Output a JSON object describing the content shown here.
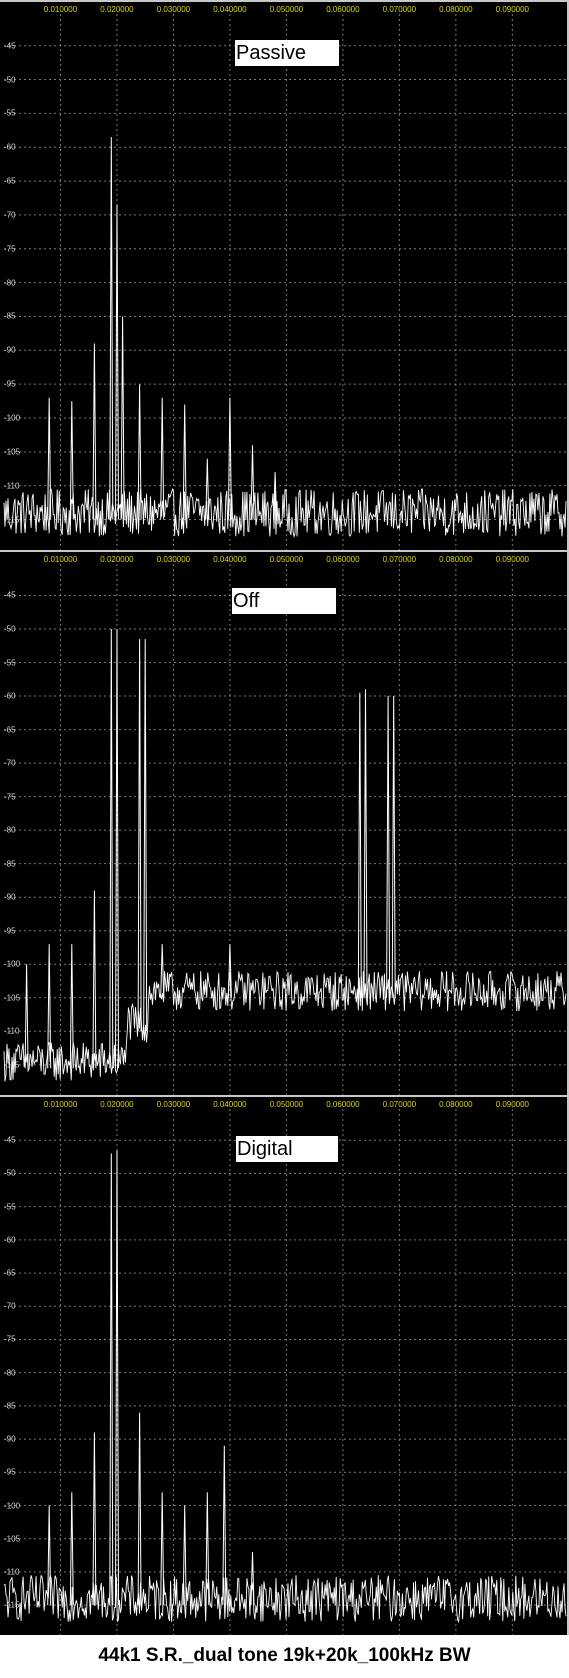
{
  "caption": "44k1 S.R._dual tone 19k+20k_100kHz BW",
  "colors": {
    "background": "#000000",
    "trace": "#ffffff",
    "grid": "#7a7a6a",
    "x_tick_label": "#d8d800",
    "y_tick_label": "#d8d8d8"
  },
  "chart_data": [
    {
      "type": "line",
      "title": "Passive",
      "x_tick_labels": [
        "0.010000",
        "0.020000",
        "0.030000",
        "0.040000",
        "0.050000",
        "0.060000",
        "0.070000",
        "0.080000",
        "0.090000"
      ],
      "x_ticks": [
        0.01,
        0.02,
        0.03,
        0.04,
        0.05,
        0.06,
        0.07,
        0.08,
        0.09
      ],
      "xlim": [
        0.0,
        0.0995
      ],
      "y_tick_labels": [
        "-45",
        "-50",
        "-55",
        "-60",
        "-65",
        "-70",
        "-75",
        "-80",
        "-85",
        "-90",
        "-95",
        "-100",
        "-105",
        "-110",
        "-115"
      ],
      "y_ticks": [
        -45,
        -50,
        -55,
        -60,
        -65,
        -70,
        -75,
        -80,
        -85,
        -90,
        -95,
        -100,
        -105,
        -110,
        -115
      ],
      "ylim": [
        -119.5,
        -41.5
      ],
      "grid": true,
      "noise_floor": -114,
      "noise_amplitude": 3.5,
      "peaks": [
        {
          "x": 0.008,
          "y": -97
        },
        {
          "x": 0.012,
          "y": -97.5
        },
        {
          "x": 0.016,
          "y": -89
        },
        {
          "x": 0.019,
          "y": -58.5
        },
        {
          "x": 0.02,
          "y": -68.5
        },
        {
          "x": 0.021,
          "y": -85
        },
        {
          "x": 0.024,
          "y": -95
        },
        {
          "x": 0.028,
          "y": -97
        },
        {
          "x": 0.032,
          "y": -98
        },
        {
          "x": 0.036,
          "y": -106
        },
        {
          "x": 0.04,
          "y": -97
        },
        {
          "x": 0.044,
          "y": -104
        },
        {
          "x": 0.048,
          "y": -108
        }
      ]
    },
    {
      "type": "line",
      "title": "Off",
      "x_tick_labels": [
        "0.010000",
        "0.020000",
        "0.030000",
        "0.040000",
        "0.050000",
        "0.060000",
        "0.070000",
        "0.080000",
        "0.090000"
      ],
      "x_ticks": [
        0.01,
        0.02,
        0.03,
        0.04,
        0.05,
        0.06,
        0.07,
        0.08,
        0.09
      ],
      "xlim": [
        0.0,
        0.0995
      ],
      "y_tick_labels": [
        "-45",
        "-50",
        "-55",
        "-60",
        "-65",
        "-70",
        "-75",
        "-80",
        "-85",
        "-90",
        "-95",
        "-100",
        "-105",
        "-110",
        "-115"
      ],
      "y_ticks": [
        -45,
        -50,
        -55,
        -60,
        -65,
        -70,
        -75,
        -80,
        -85,
        -90,
        -95,
        -100,
        -105,
        -110,
        -115
      ],
      "ylim": [
        -119.5,
        -41.5
      ],
      "grid": true,
      "noise_segments": [
        {
          "x0": 0.0,
          "x1": 0.0215,
          "floor": -114.5
        },
        {
          "x0": 0.0215,
          "x1": 0.0255,
          "floor": -109
        },
        {
          "x0": 0.0255,
          "x1": 0.0995,
          "floor": -104
        }
      ],
      "noise_amplitude": 3.0,
      "peaks": [
        {
          "x": 0.004,
          "y": -100
        },
        {
          "x": 0.008,
          "y": -97
        },
        {
          "x": 0.012,
          "y": -97
        },
        {
          "x": 0.016,
          "y": -89
        },
        {
          "x": 0.019,
          "y": -50
        },
        {
          "x": 0.02,
          "y": -50
        },
        {
          "x": 0.024,
          "y": -51.5
        },
        {
          "x": 0.025,
          "y": -51.5
        },
        {
          "x": 0.028,
          "y": -97
        },
        {
          "x": 0.04,
          "y": -97
        },
        {
          "x": 0.063,
          "y": -59.5
        },
        {
          "x": 0.064,
          "y": -59
        },
        {
          "x": 0.068,
          "y": -60
        },
        {
          "x": 0.069,
          "y": -60
        }
      ]
    },
    {
      "type": "line",
      "title": "Digital",
      "x_tick_labels": [
        "0.010000",
        "0.020000",
        "0.030000",
        "0.040000",
        "0.050000",
        "0.060000",
        "0.070000",
        "0.080000",
        "0.090000"
      ],
      "x_ticks": [
        0.01,
        0.02,
        0.03,
        0.04,
        0.05,
        0.06,
        0.07,
        0.08,
        0.09
      ],
      "xlim": [
        0.0,
        0.0995
      ],
      "y_tick_labels": [
        "-45",
        "-50",
        "-55",
        "-60",
        "-65",
        "-70",
        "-75",
        "-80",
        "-85",
        "-90",
        "-95",
        "-100",
        "-105",
        "-110",
        "-115"
      ],
      "y_ticks": [
        -45,
        -50,
        -55,
        -60,
        -65,
        -70,
        -75,
        -80,
        -85,
        -90,
        -95,
        -100,
        -105,
        -110,
        -115
      ],
      "ylim": [
        -119.5,
        -41.5
      ],
      "grid": true,
      "noise_floor": -114,
      "noise_amplitude": 3.5,
      "peaks": [
        {
          "x": 0.008,
          "y": -100
        },
        {
          "x": 0.012,
          "y": -98
        },
        {
          "x": 0.016,
          "y": -89
        },
        {
          "x": 0.019,
          "y": -47
        },
        {
          "x": 0.02,
          "y": -46.5
        },
        {
          "x": 0.024,
          "y": -86
        },
        {
          "x": 0.028,
          "y": -98
        },
        {
          "x": 0.032,
          "y": -100
        },
        {
          "x": 0.036,
          "y": -98
        },
        {
          "x": 0.039,
          "y": -91
        },
        {
          "x": 0.044,
          "y": -107
        }
      ]
    }
  ]
}
